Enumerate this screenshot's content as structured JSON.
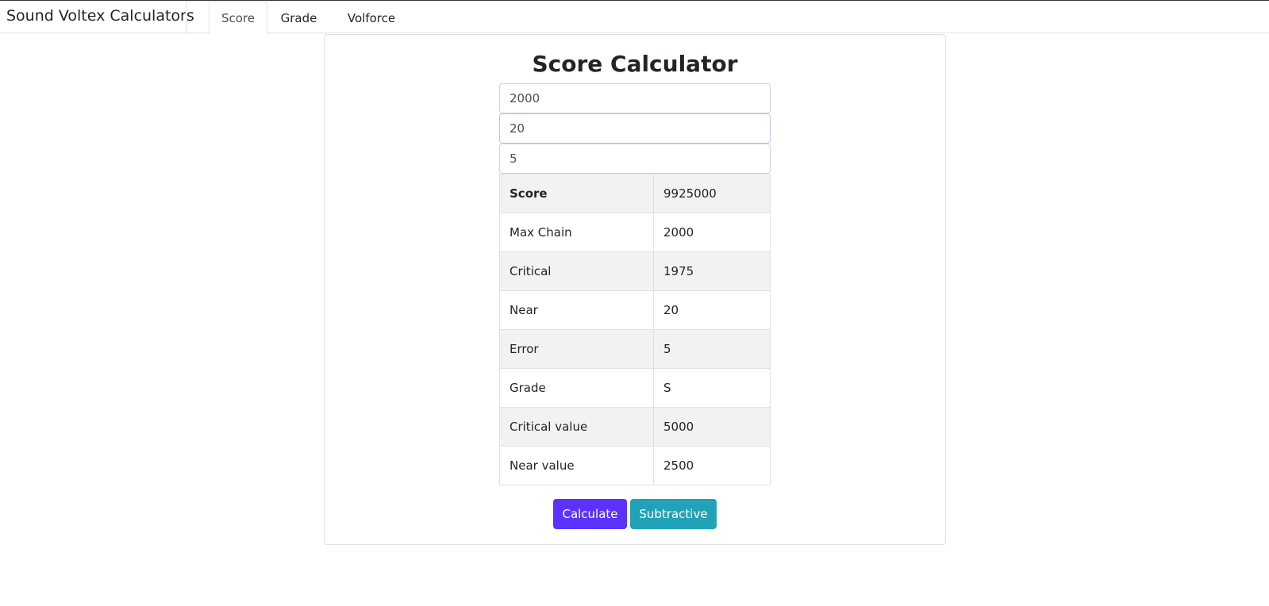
{
  "app": {
    "title": "Sound Voltex Calculators"
  },
  "tabs": [
    {
      "label": "Score",
      "active": true
    },
    {
      "label": "Grade",
      "active": false
    },
    {
      "label": "Volforce",
      "active": false
    }
  ],
  "calculator": {
    "heading": "Score Calculator",
    "inputs": [
      {
        "value": "2000"
      },
      {
        "value": "20"
      },
      {
        "value": "5"
      }
    ],
    "results": [
      {
        "label": "Score",
        "value": "9925000"
      },
      {
        "label": "Max Chain",
        "value": "2000"
      },
      {
        "label": "Critical",
        "value": "1975"
      },
      {
        "label": "Near",
        "value": "20"
      },
      {
        "label": "Error",
        "value": "5"
      },
      {
        "label": "Grade",
        "value": "S"
      },
      {
        "label": "Critical value",
        "value": "5000"
      },
      {
        "label": "Near value",
        "value": "2500"
      }
    ],
    "buttons": {
      "calculate": "Calculate",
      "subtractive": "Subtractive"
    }
  },
  "colors": {
    "calculate_button": "#5b32ff",
    "subtractive_button": "#22a2b8"
  }
}
